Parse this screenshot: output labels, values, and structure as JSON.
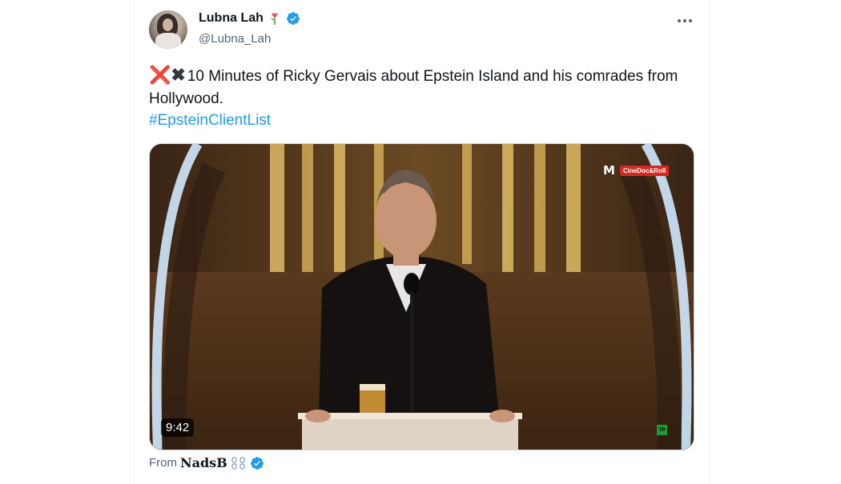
{
  "author": {
    "display_name": "Lubna Lah",
    "name_emoji": "tulip",
    "handle": "@Lubna_Lah",
    "verified": true
  },
  "tweet": {
    "emoji_prefix": [
      "❌",
      "✖"
    ],
    "text": "10 Minutes of Ricky Gervais about Epstein Island and his comrades from Hollywood.",
    "hashtag": "#EpsteinClientList"
  },
  "video": {
    "duration": "9:42",
    "channel_mark": "M",
    "channel_name": "CineDoc&Roll",
    "corner_badge": "TP"
  },
  "attribution": {
    "prefix": "From",
    "name": "NadsB",
    "verified": true
  },
  "colors": {
    "link": "#1d9bf0",
    "verified": "#1d9bf0",
    "text": "#0f1419",
    "secondary": "#536471"
  }
}
